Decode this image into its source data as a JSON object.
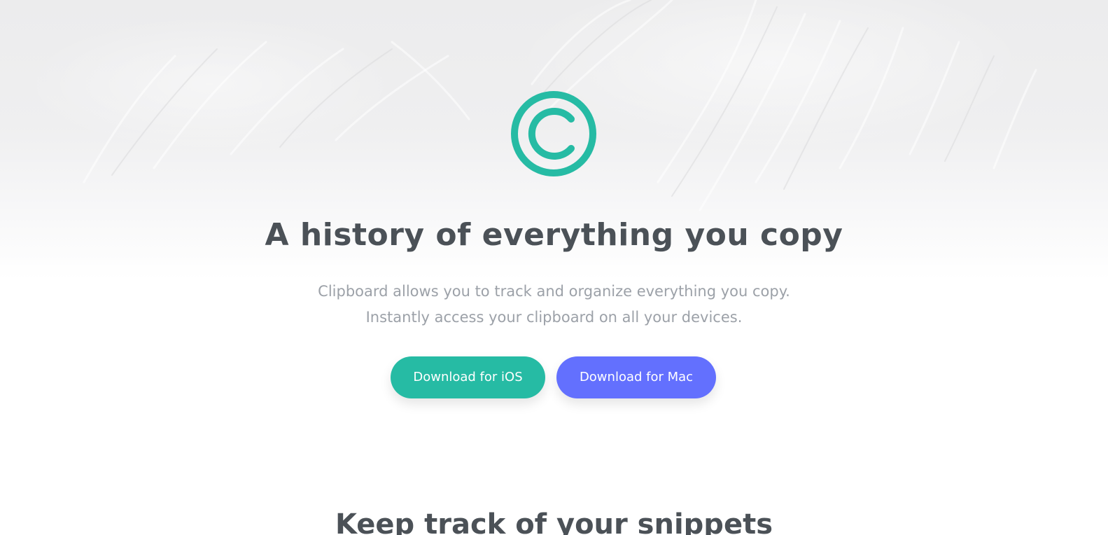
{
  "hero": {
    "logo_icon": "copyright-c-icon",
    "headline": "A history of everything you copy",
    "subtitle_line1": "Clipboard allows you to track and organize everything you copy.",
    "subtitle_line2": "Instantly access your clipboard on all your devices."
  },
  "buttons": {
    "ios_label": "Download for iOS",
    "mac_label": "Download for Mac"
  },
  "features": {
    "section_title": "Keep track of your snippets"
  },
  "colors": {
    "accent_teal": "#26bba4",
    "accent_blue": "#6370fe",
    "heading": "#4b5157",
    "body_text": "#9ca1a8"
  }
}
